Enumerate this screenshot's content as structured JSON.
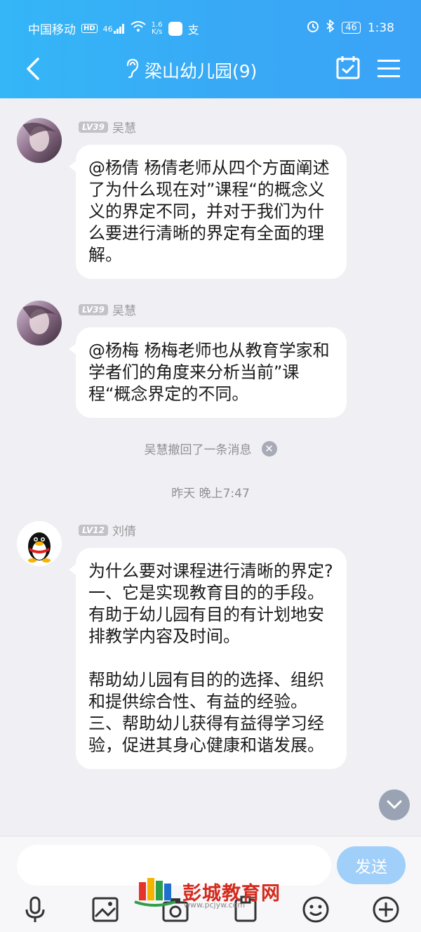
{
  "status_bar": {
    "carrier": "中国移动",
    "hd": "HD",
    "net": "46",
    "speed": "1.6",
    "speed_unit": "K/s",
    "battery": "46",
    "time": "1:38"
  },
  "header": {
    "title": "梁山幼儿园(9)"
  },
  "messages": [
    {
      "level": "LV39",
      "sender": "吴慧",
      "text": "@杨倩 杨倩老师从四个方面阐述了为什么现在对”课程“的概念义义的界定不同，并对于我们为什么要进行清晰的界定有全面的理解。"
    },
    {
      "level": "LV39",
      "sender": "吴慧",
      "text": "@杨梅 杨梅老师也从教育学家和学者们的角度来分析当前”课程“概念界定的不同。"
    },
    {
      "level": "LV12",
      "sender": "刘倩",
      "text": "为什么要对课程进行清晰的界定?一、它是实现教育目的的手段。有助于幼儿园有目的有计划地安排教学内容及时间。\n\n帮助幼儿园有目的的选择、组织和提供综合性、有益的经验。三、帮助幼儿获得有益得学习经验，促进其身心健康和谐发展。"
    }
  ],
  "system": {
    "recall_notice": "吴慧撤回了一条消息",
    "timestamp": "昨天 晚上7:47"
  },
  "input": {
    "placeholder": "",
    "send_label": "发送"
  },
  "watermark": {
    "text": "彭城教育网",
    "url": "www.pcjyw.com"
  },
  "icons": {
    "back": "back-arrow-icon",
    "listen": "ear-icon",
    "calendar": "calendar-check-icon",
    "menu": "hamburger-menu-icon",
    "voice": "microphone-icon",
    "image": "image-icon",
    "camera": "camera-icon",
    "file": "file-icon",
    "emoji": "emoji-icon",
    "more": "plus-circle-icon"
  },
  "colors": {
    "header": "#39a8f5",
    "send_button": "#a0cff9",
    "chat_bg": "#efeff4"
  }
}
